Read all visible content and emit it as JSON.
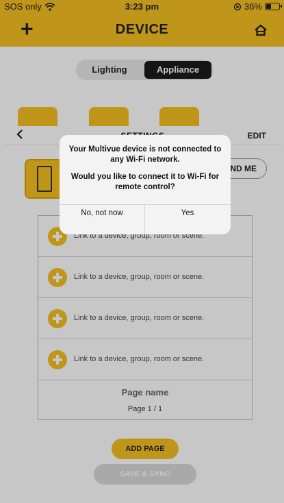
{
  "status_bar": {
    "carrier": "SOS only",
    "time": "3:23 pm",
    "battery": "36%",
    "battery_level": 0.36
  },
  "header": {
    "add_icon": "plus-icon",
    "title": "DEVICE",
    "home_icon": "home-icon"
  },
  "segmented": {
    "options": [
      "Lighting",
      "Appliance"
    ],
    "selected": "Appliance"
  },
  "settings": {
    "back_icon": "chevron-left-icon",
    "title": "SETTINGS",
    "edit_label": "EDIT",
    "find_me_label": "ND ME",
    "link_rows": [
      "Link to a device, group, room or scene.",
      "Link to a device, group, room or scene.",
      "Link to a device, group, room or scene.",
      "Link to a device, group, room or scene."
    ],
    "page_name": "Page name",
    "page_count": "Page 1 / 1",
    "add_page_label": "ADD PAGE",
    "save_sync_label": "SAVE & SYNC"
  },
  "alert": {
    "message_line1": "Your Multivue device is not connected to any Wi-Fi network.",
    "message_line2": "Would you like to connect it to Wi-Fi for remote control?",
    "cancel_label": "No, not now",
    "confirm_label": "Yes"
  },
  "colors": {
    "accent": "#f5c021",
    "dark": "#1c1c1c",
    "disabled_button": "#d9d9d9"
  }
}
